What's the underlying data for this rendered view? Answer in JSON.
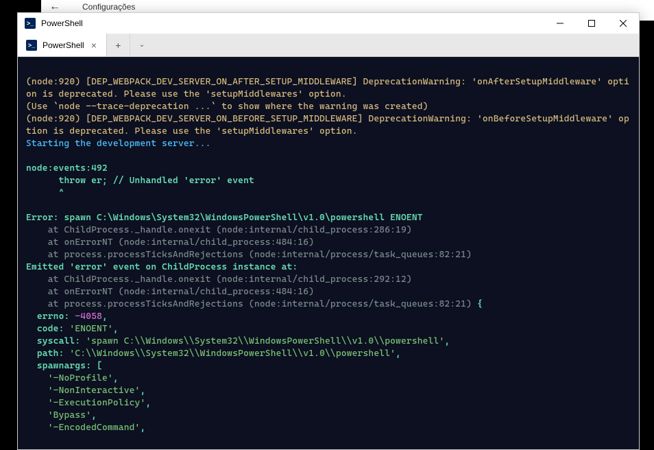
{
  "bgWindow": {
    "title": "Configurações"
  },
  "window": {
    "title": "PowerShell"
  },
  "tabs": {
    "active": "PowerShell"
  },
  "terminal": {
    "line1a": "(node:920) [DEP_WEBPACK_DEV_SERVER_ON_AFTER_SETUP_MIDDLEWARE] DeprecationWarning: 'onAfterSetupMiddleware' option is deprecated. Please use the 'setupMiddlewares' option.",
    "line2": "(Use `node --trace-deprecation ...` to show where the warning was created)",
    "line3a": "(node:920) [DEP_WEBPACK_DEV_SERVER_ON_BEFORE_SETUP_MIDDLEWARE] DeprecationWarning: 'onBeforeSetupMiddleware' option is deprecated. Please use the 'setupMiddlewares' option.",
    "starting": "Starting the development server...",
    "events": "node:events:492",
    "throw": "      throw er; // Unhandled 'error' event",
    "caret": "      ^",
    "error_head": "Error: spawn C:\\Windows\\System32\\WindowsPowerShell\\v1.0\\powershell ENOENT",
    "stack1": "    at ChildProcess._handle.onexit (node:internal/child_process:286:19)",
    "stack2": "    at onErrorNT (node:internal/child_process:484:16)",
    "stack3": "    at process.processTicksAndRejections (node:internal/process/task_queues:82:21)",
    "emitted": "Emitted 'error' event on ChildProcess instance at:",
    "stack4": "    at ChildProcess._handle.onexit (node:internal/child_process:292:12)",
    "stack5": "    at onErrorNT (node:internal/child_process:484:16)",
    "stack6_pre": "    at process.processTicksAndRejections (node:internal/process/task_queues:82:21) ",
    "brace_open": "{",
    "errno_k": "  errno: ",
    "errno_v": "-4058",
    "comma": ",",
    "code_k": "  code: ",
    "code_v": "'ENOENT'",
    "syscall_k": "  syscall: ",
    "syscall_v": "'spawn C:\\\\Windows\\\\System32\\\\WindowsPowerShell\\\\v1.0\\\\powershell'",
    "path_k": "  path: ",
    "path_v": "'C:\\\\Windows\\\\System32\\\\WindowsPowerShell\\\\v1.0\\\\powershell'",
    "spawnargs_k": "  spawnargs: ",
    "bracket_open": "[",
    "arg1": "    '-NoProfile'",
    "arg2": "    '-NonInteractive'",
    "arg3": "    '-ExecutionPolicy'",
    "arg4": "    'Bypass'",
    "arg5": "    '-EncodedCommand'"
  }
}
